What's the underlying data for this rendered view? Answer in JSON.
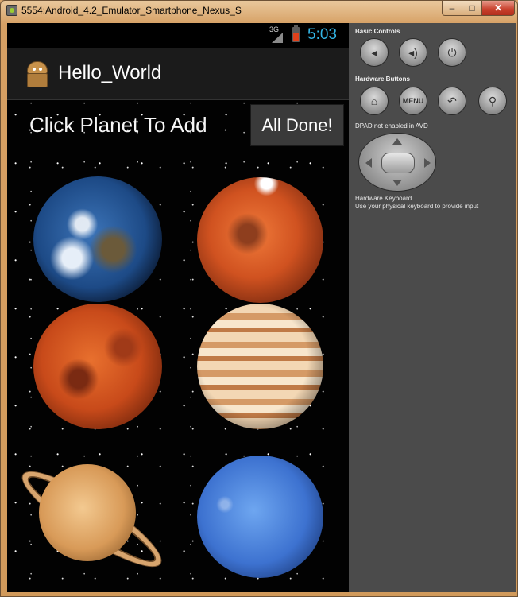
{
  "window": {
    "title": "5554:Android_4.2_Emulator_Smartphone_Nexus_S",
    "minimize_glyph": "–",
    "maximize_glyph": "□",
    "close_glyph": "✕"
  },
  "status_bar": {
    "network": "3G",
    "time": "5:03"
  },
  "action_bar": {
    "title": "Hello_World",
    "icon": "android-robot-icon"
  },
  "main": {
    "prompt": "Click Planet To Add",
    "done_button": "All Done!",
    "planets": [
      "earth",
      "mars",
      "venus",
      "jupiter",
      "saturn",
      "neptune"
    ]
  },
  "controls": {
    "basic_controls_label": "Basic Controls",
    "basic_buttons": [
      "volume-down-icon",
      "volume-up-icon",
      "power-icon"
    ],
    "hardware_buttons_label": "Hardware Buttons",
    "hardware_buttons": [
      "home-icon",
      "menu",
      "back-icon",
      "search-icon"
    ],
    "menu_label": "MENU",
    "dpad_label": "DPAD not enabled in AVD",
    "keyboard_label": "Hardware Keyboard",
    "keyboard_hint": "Use your physical keyboard to provide input"
  },
  "colors": {
    "clock": "#33b5e5",
    "window_frame": "#d9a56b",
    "panel": "#4b4b4b"
  }
}
